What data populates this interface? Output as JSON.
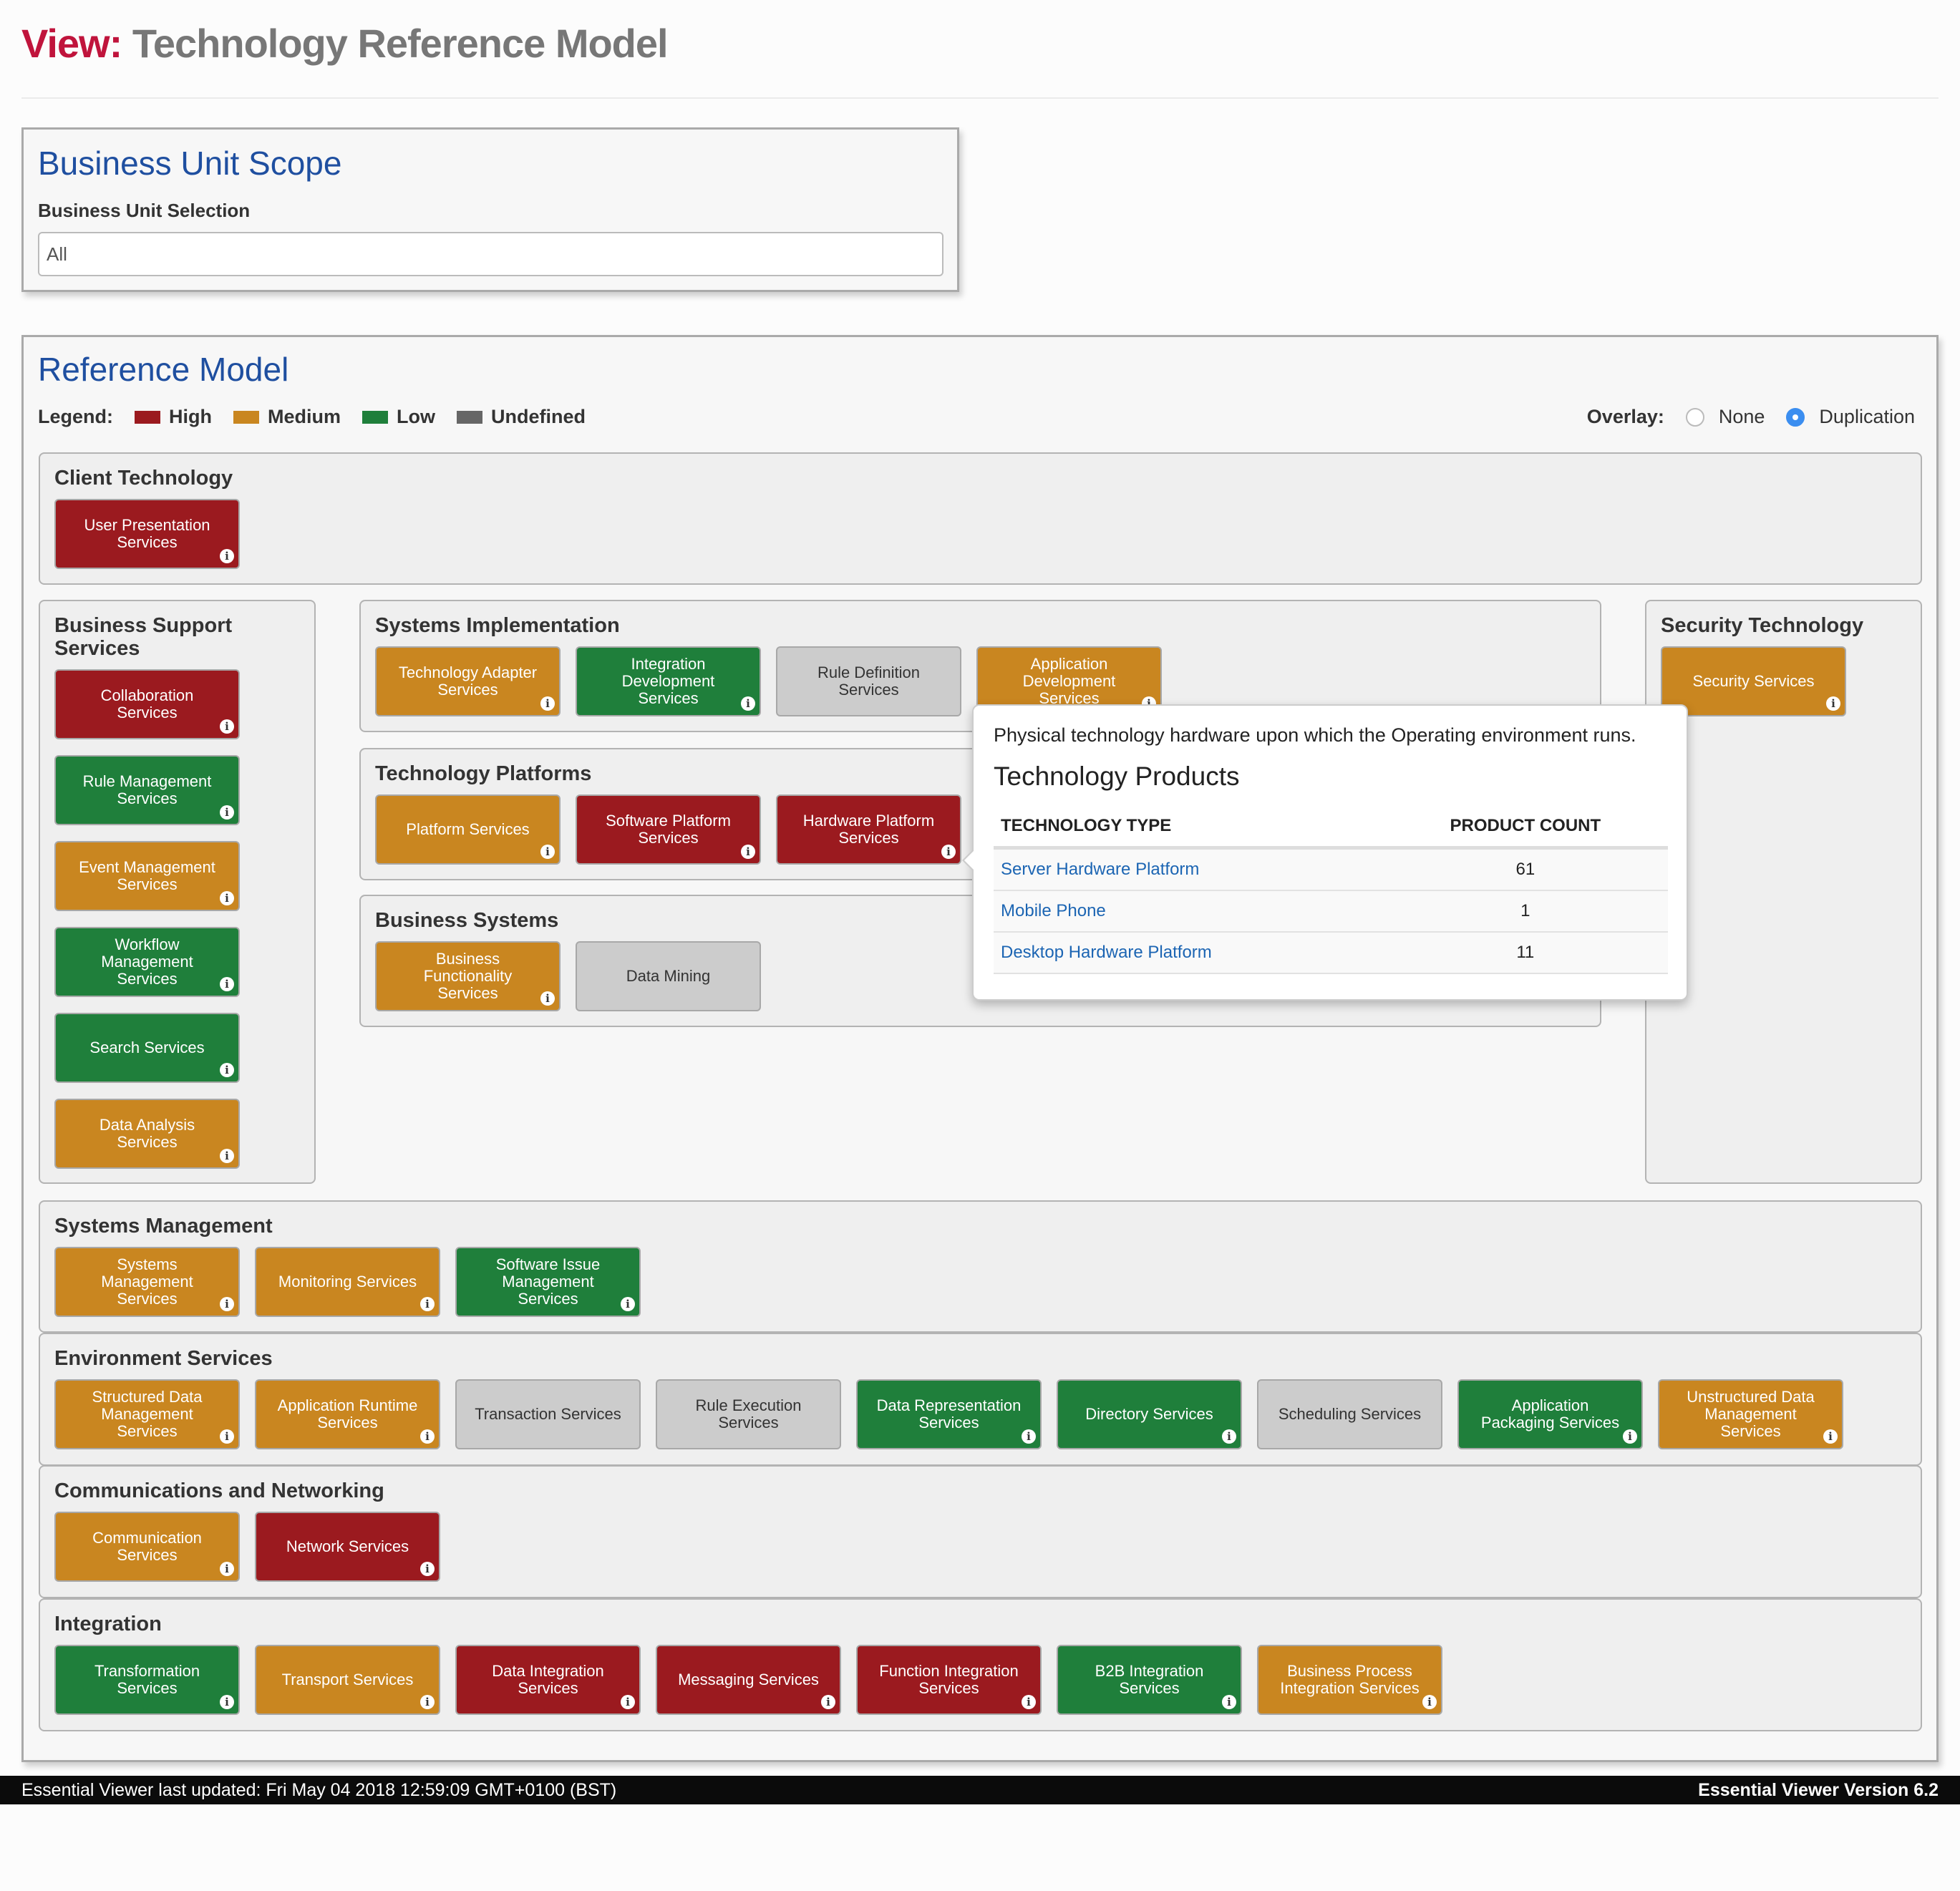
{
  "header": {
    "view_label": "View:",
    "title": "Technology Reference Model"
  },
  "scope": {
    "title": "Business Unit Scope",
    "selection_label": "Business Unit Selection",
    "selection_value": "All"
  },
  "reference_model": {
    "title": "Reference Model",
    "legend_label": "Legend:",
    "legend": [
      {
        "label": "High",
        "color": "#9b1a1f"
      },
      {
        "label": "Medium",
        "color": "#c98620"
      },
      {
        "label": "Low",
        "color": "#1f7f3b"
      },
      {
        "label": "Undefined",
        "color": "#666666"
      }
    ],
    "overlay_label": "Overlay:",
    "overlay_options": [
      {
        "label": "None",
        "selected": false
      },
      {
        "label": "Duplication",
        "selected": true
      }
    ],
    "panels": {
      "client": {
        "title": "Client Technology",
        "tiles": [
          {
            "label": "User Presentation Services",
            "level": "high",
            "info": true
          }
        ]
      },
      "business_support": {
        "title": "Business Support Services",
        "tiles": [
          {
            "label": "Collaboration Services",
            "level": "high",
            "info": true
          },
          {
            "label": "Rule Management Services",
            "level": "low",
            "info": true
          },
          {
            "label": "Event Management Services",
            "level": "medium",
            "info": true
          },
          {
            "label": "Workflow Management Services",
            "level": "low",
            "info": true
          },
          {
            "label": "Search Services",
            "level": "low",
            "info": true
          },
          {
            "label": "Data Analysis Services",
            "level": "medium",
            "info": true
          }
        ]
      },
      "systems_impl": {
        "title": "Systems Implementation",
        "tiles": [
          {
            "label": "Technology Adapter Services",
            "level": "medium",
            "info": true
          },
          {
            "label": "Integration Development Services",
            "level": "low",
            "info": true
          },
          {
            "label": "Rule Definition Services",
            "level": "undefined",
            "info": false
          },
          {
            "label": "Application Development Services",
            "level": "medium",
            "info": true
          }
        ]
      },
      "tech_platforms": {
        "title": "Technology Platforms",
        "tiles": [
          {
            "label": "Platform Services",
            "level": "medium",
            "info": true
          },
          {
            "label": "Software Platform Services",
            "level": "high",
            "info": true
          },
          {
            "label": "Hardware Platform Services",
            "level": "high",
            "info": true
          }
        ]
      },
      "business_systems": {
        "title": "Business Systems",
        "tiles": [
          {
            "label": "Business Functionality Services",
            "level": "medium",
            "info": true
          },
          {
            "label": "Data Mining",
            "level": "undefined",
            "info": false
          }
        ]
      },
      "security": {
        "title": "Security Technology",
        "tiles": [
          {
            "label": "Security Services",
            "level": "medium",
            "info": true
          }
        ]
      },
      "systems_mgmt": {
        "title": "Systems Management",
        "tiles": [
          {
            "label": "Systems Management Services",
            "level": "medium",
            "info": true
          },
          {
            "label": "Monitoring Services",
            "level": "medium",
            "info": true
          },
          {
            "label": "Software Issue Management Services",
            "level": "low",
            "info": true
          }
        ]
      },
      "environment": {
        "title": "Environment Services",
        "tiles": [
          {
            "label": "Structured Data Management Services",
            "level": "medium",
            "info": true
          },
          {
            "label": "Application Runtime Services",
            "level": "medium",
            "info": true
          },
          {
            "label": "Transaction Services",
            "level": "undefined",
            "info": false
          },
          {
            "label": "Rule Execution Services",
            "level": "undefined",
            "info": false
          },
          {
            "label": "Data Representation Services",
            "level": "low",
            "info": true
          },
          {
            "label": "Directory Services",
            "level": "low",
            "info": true
          },
          {
            "label": "Scheduling Services",
            "level": "undefined",
            "info": false
          },
          {
            "label": "Application Packaging Services",
            "level": "low",
            "info": true
          },
          {
            "label": "Unstructured Data Management Services",
            "level": "medium",
            "info": true
          }
        ]
      },
      "comms": {
        "title": "Communications and Networking",
        "tiles": [
          {
            "label": "Communication Services",
            "level": "medium",
            "info": true
          },
          {
            "label": "Network Services",
            "level": "high",
            "info": true
          }
        ]
      },
      "integration": {
        "title": "Integration",
        "tiles": [
          {
            "label": "Transformation Services",
            "level": "low",
            "info": true
          },
          {
            "label": "Transport Services",
            "level": "medium",
            "info": true
          },
          {
            "label": "Data Integration Services",
            "level": "high",
            "info": true
          },
          {
            "label": "Messaging Services",
            "level": "high",
            "info": true
          },
          {
            "label": "Function Integration Services",
            "level": "high",
            "info": true
          },
          {
            "label": "B2B Integration Services",
            "level": "low",
            "info": true
          },
          {
            "label": "Business Process Integration Services",
            "level": "medium",
            "info": true
          }
        ]
      }
    }
  },
  "tooltip": {
    "description": "Physical technology hardware upon which the Operating environment runs.",
    "title": "Technology Products",
    "columns": [
      "TECHNOLOGY TYPE",
      "PRODUCT COUNT"
    ],
    "rows": [
      {
        "type": "Server Hardware Platform",
        "count": "61"
      },
      {
        "type": "Mobile Phone",
        "count": "1"
      },
      {
        "type": "Desktop Hardware Platform",
        "count": "11"
      }
    ]
  },
  "footer": {
    "last_updated": "Essential Viewer last updated: Fri May 04 2018 12:59:09 GMT+0100 (BST)",
    "version": "Essential Viewer Version 6.2"
  },
  "icons": {
    "info": "info-circle-icon"
  }
}
